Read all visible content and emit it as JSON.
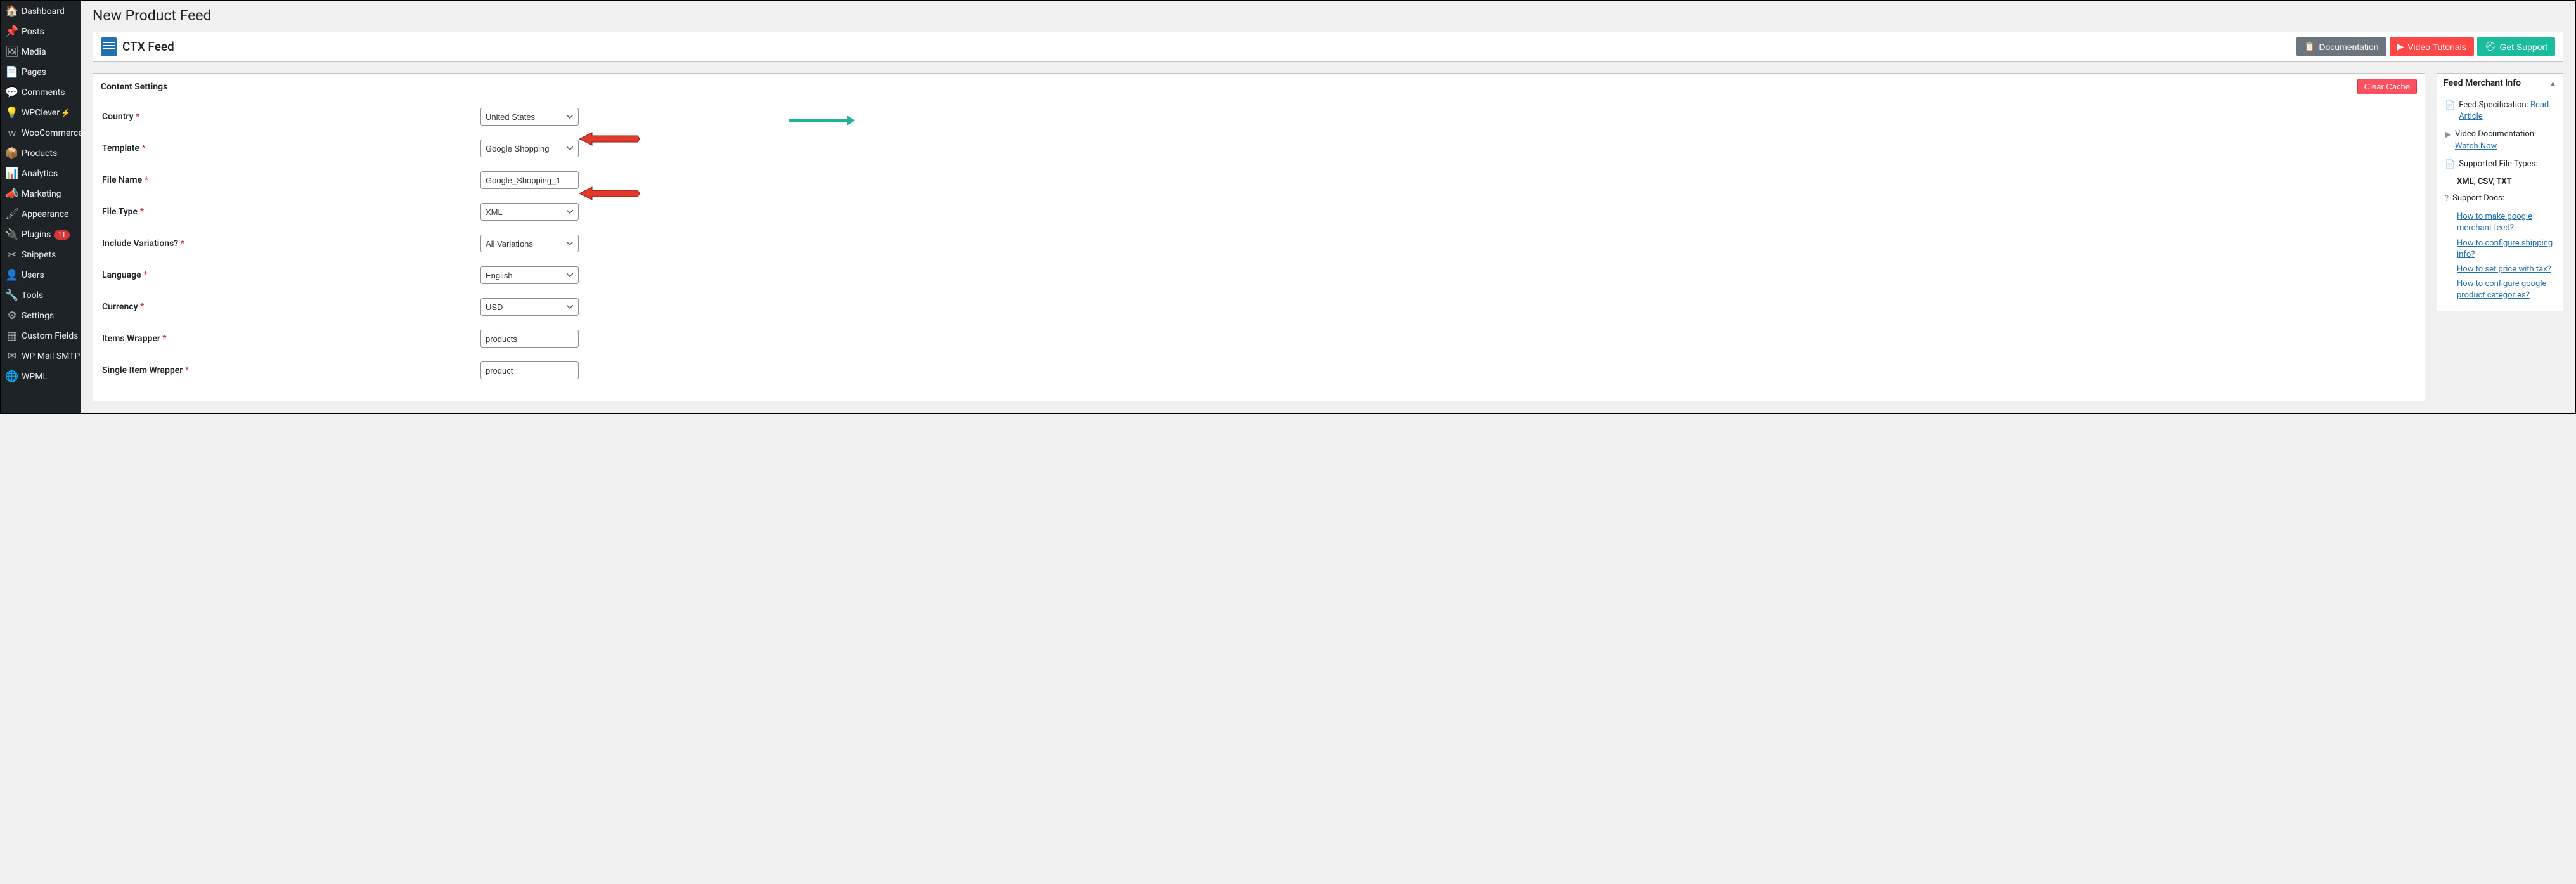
{
  "sidebar": {
    "items": [
      {
        "label": "Dashboard"
      },
      {
        "label": "Posts"
      },
      {
        "label": "Media"
      },
      {
        "label": "Pages"
      },
      {
        "label": "Comments"
      },
      {
        "label": "WPClever"
      },
      {
        "label": "WooCommerce"
      },
      {
        "label": "Products"
      },
      {
        "label": "Analytics"
      },
      {
        "label": "Marketing"
      },
      {
        "label": "Appearance"
      },
      {
        "label": "Plugins"
      },
      {
        "label": "Snippets"
      },
      {
        "label": "Users"
      },
      {
        "label": "Tools"
      },
      {
        "label": "Settings"
      },
      {
        "label": "Custom Fields"
      },
      {
        "label": "WP Mail SMTP"
      },
      {
        "label": "WPML"
      }
    ],
    "plugins_badge": "11"
  },
  "page": {
    "title": "New Product Feed",
    "app_name": "CTX Feed"
  },
  "topbar": {
    "doc": "Documentation",
    "video": "Video Tutorials",
    "support": "Get Support"
  },
  "content_panel": {
    "header": "Content Settings",
    "clear_cache": "Clear Cache",
    "fields": {
      "country": {
        "label": "Country",
        "value": "United States"
      },
      "template": {
        "label": "Template",
        "value": "Google Shopping"
      },
      "file_name": {
        "label": "File Name",
        "value": "Google_Shopping_1"
      },
      "file_type": {
        "label": "File Type",
        "value": "XML"
      },
      "include_variations": {
        "label": "Include Variations?",
        "value": "All Variations"
      },
      "language": {
        "label": "Language",
        "value": "English"
      },
      "currency": {
        "label": "Currency",
        "value": "USD"
      },
      "items_wrapper": {
        "label": "Items Wrapper",
        "value": "products"
      },
      "single_item_wrapper": {
        "label": "Single Item Wrapper",
        "value": "product"
      }
    }
  },
  "merchant_panel": {
    "header": "Feed Merchant Info",
    "feed_spec_label": "Feed Specification:",
    "feed_spec_link": "Read Article",
    "video_doc_label": "Video Documentation:",
    "video_doc_link": "Watch Now",
    "file_types_label": "Supported File Types:",
    "file_types_value": "XML, CSV, TXT",
    "support_docs_label": "Support Docs:",
    "links": [
      "How to make google merchant feed?",
      "How to configure shipping info?",
      "How to set price with tax?",
      "How to configure google product categories?"
    ]
  }
}
